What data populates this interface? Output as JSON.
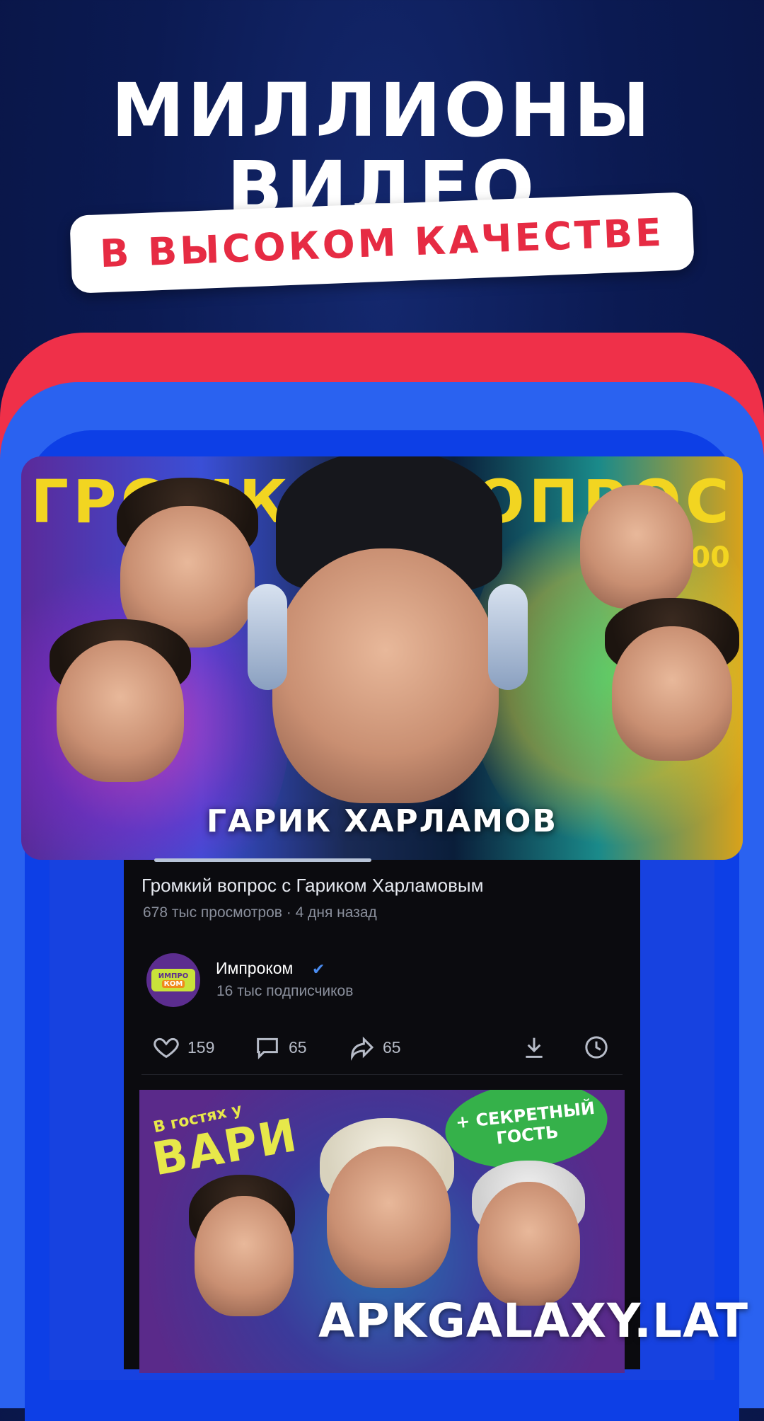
{
  "headline": {
    "line1": "МИЛЛИОНЫ",
    "line2": "ВИДЕО",
    "pill": "В ВЫСОКОМ КАЧЕСТВЕ"
  },
  "colors": {
    "background": "#0b1a52",
    "accent_red": "#ef3049",
    "accent_blue": "#2a62f0",
    "screen": "#0b0b0f",
    "verified": "#4a8cf0"
  },
  "video": {
    "thumbnail_title": "ГРОМКИЙ ВОПРОС",
    "thumbnail_price": "₽100",
    "thumbnail_caption": "ГАРИК ХАРЛАМОВ",
    "watch_progress": 0.42,
    "title": "Громкий вопрос с Гариком Харламовым",
    "meta": "678 тыс просмотров · 4 дня назад",
    "channel": {
      "name": "Импроком",
      "logo_top": "ИМПРО",
      "logo_bottom": "КОМ",
      "subscribers": "16 тыс подписчиков",
      "verified_icon": "check-icon"
    },
    "actions": {
      "likes": "159",
      "comments": "65",
      "shares": "65"
    }
  },
  "next_video": {
    "logo_small": "В гостях у",
    "logo_big": "ВАРИ",
    "badge": "+ СЕКРЕТНЫЙ ГОСТЬ"
  },
  "watermark": "APKGALAXY.LAT"
}
